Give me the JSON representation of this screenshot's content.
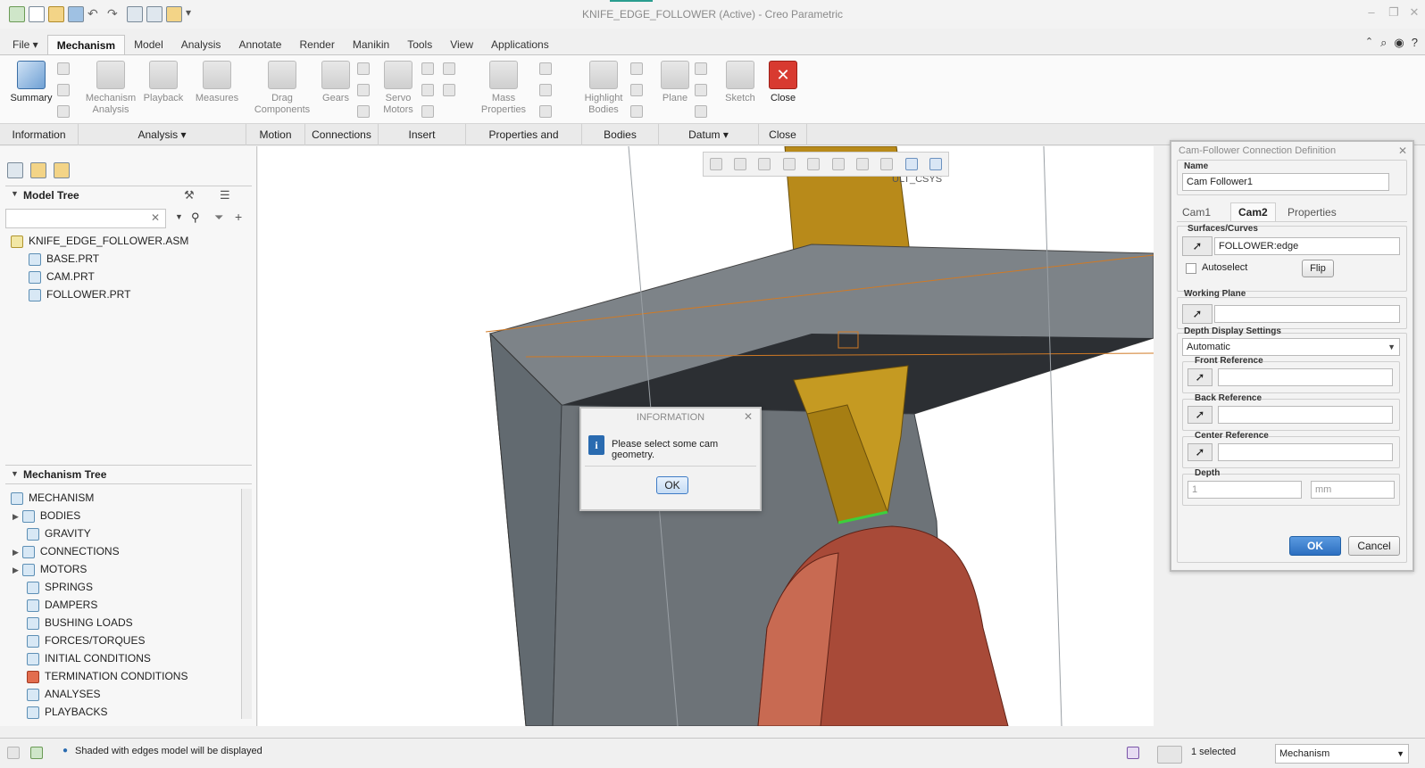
{
  "window": {
    "title": "KNIFE_EDGE_FOLLOWER (Active) - Creo Parametric",
    "minimize_icon": "minimize-icon",
    "maximize_icon": "maximize-icon",
    "close_icon": "close-icon"
  },
  "menu_tabs": [
    "File ▾",
    "Mechanism",
    "Model",
    "Analysis",
    "Annotate",
    "Render",
    "Manikin",
    "Tools",
    "View",
    "Applications"
  ],
  "ribbon": {
    "buttons": {
      "summary": "Summary",
      "mechanism_analysis_1": "Mechanism",
      "mechanism_analysis_2": "Analysis",
      "playback": "Playback",
      "measures": "Measures",
      "drag_1": "Drag",
      "drag_2": "Components",
      "gears": "Gears",
      "servo_1": "Servo",
      "servo_2": "Motors",
      "mass_1": "Mass",
      "mass_2": "Properties",
      "highlight_1": "Highlight",
      "highlight_2": "Bodies",
      "plane": "Plane",
      "sketch": "Sketch",
      "close": "Close"
    },
    "groups": [
      "Information",
      "Analysis ▾",
      "Motion",
      "Connections",
      "Insert",
      "Properties and Conditions",
      "Bodies",
      "Datum ▾",
      "Close"
    ]
  },
  "model_tree": {
    "title": "Model Tree",
    "search_placeholder": "",
    "items": [
      "KNIFE_EDGE_FOLLOWER.ASM",
      "BASE.PRT",
      "CAM.PRT",
      "FOLLOWER.PRT"
    ]
  },
  "mechanism_tree": {
    "title": "Mechanism Tree",
    "items": [
      "MECHANISM",
      "BODIES",
      "GRAVITY",
      "CONNECTIONS",
      "MOTORS",
      "SPRINGS",
      "DAMPERS",
      "BUSHING LOADS",
      "FORCES/TORQUES",
      "INITIAL CONDITIONS",
      "TERMINATION CONDITIONS",
      "ANALYSES",
      "PLAYBACKS"
    ]
  },
  "viewport": {
    "csys_label": "ULT_CSYS"
  },
  "info_dialog": {
    "title": "INFORMATION",
    "message": "Please select some cam geometry.",
    "ok": "OK"
  },
  "cam_dialog": {
    "title": "Cam-Follower Connection Definition",
    "name_label": "Name",
    "name_value": "Cam Follower1",
    "tabs": [
      "Cam1",
      "Cam2",
      "Properties"
    ],
    "surfaces_label": "Surfaces/Curves",
    "surfaces_value": "FOLLOWER:edge",
    "autoselect": "Autoselect",
    "flip": "Flip",
    "working_plane": "Working Plane",
    "depth_settings": "Depth Display Settings",
    "depth_mode": "Automatic",
    "front_ref": "Front Reference",
    "back_ref": "Back Reference",
    "center_ref": "Center Reference",
    "depth": "Depth",
    "depth_value": "1",
    "depth_unit": "mm",
    "ok": "OK",
    "cancel": "Cancel"
  },
  "status": {
    "message": "Shaded with edges model will be displayed",
    "selected": "1 selected",
    "filter": "Mechanism"
  },
  "colors": {
    "accent": "#2a6bb0",
    "gold": "#b88a1a",
    "gray_body": "#6d7378",
    "cam": "#b0543f"
  }
}
